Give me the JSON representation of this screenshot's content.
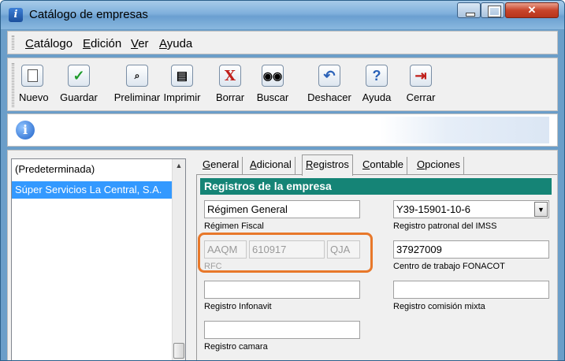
{
  "window": {
    "title": "Catálogo de empresas"
  },
  "menu": [
    "Catálogo",
    "Edición",
    "Ver",
    "Ayuda"
  ],
  "toolbar": [
    {
      "label": "Nuevo",
      "icon": "new-document-icon",
      "glyph": "▭"
    },
    {
      "label": "Guardar",
      "icon": "checkmark-icon",
      "glyph": "✓"
    },
    {
      "label": "Preliminar",
      "icon": "print-preview-icon",
      "glyph": "🔍"
    },
    {
      "label": "Imprimir",
      "icon": "printer-icon",
      "glyph": "▤"
    },
    {
      "label": "Borrar",
      "icon": "delete-x-icon",
      "glyph": "X"
    },
    {
      "label": "Buscar",
      "icon": "binoculars-icon",
      "glyph": "▣"
    },
    {
      "label": "Deshacer",
      "icon": "undo-icon",
      "glyph": "↶"
    },
    {
      "label": "Ayuda",
      "icon": "help-icon",
      "glyph": "?"
    },
    {
      "label": "Cerrar",
      "icon": "exit-door-icon",
      "glyph": "⇥"
    }
  ],
  "list": {
    "items": [
      "(Predeterminada)",
      "Súper Servicios La Central, S.A."
    ],
    "selected_index": 1
  },
  "tabs": [
    "General",
    "Adicional",
    "Registros",
    "Contable",
    "Opciones"
  ],
  "active_tab": "Registros",
  "panel": {
    "header": "Registros de la empresa",
    "regimen_fiscal": {
      "value": "Régimen General",
      "label": "Régimen Fiscal"
    },
    "registro_patronal": {
      "value": "Y39-15901-10-6",
      "label": "Registro patronal del IMSS"
    },
    "rfc": {
      "part1": "AAQM",
      "part2": "610917",
      "part3": "QJA",
      "label": "RFC"
    },
    "fonacot": {
      "value": "37927009",
      "label": "Centro de trabajo FONACOT"
    },
    "infonavit": {
      "value": "",
      "label": "Registro Infonavit"
    },
    "comision_mixta": {
      "value": "",
      "label": "Registro comisión mixta"
    },
    "camara": {
      "value": "",
      "label": "Registro camara"
    }
  },
  "colors": {
    "section_header": "#158476",
    "highlight": "#e8782a",
    "selection": "#3399ff"
  }
}
